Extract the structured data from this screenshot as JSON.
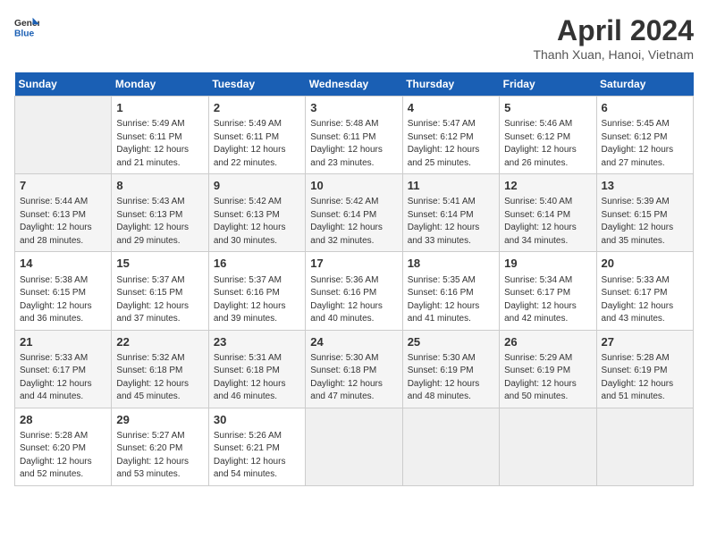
{
  "header": {
    "logo_line1": "General",
    "logo_line2": "Blue",
    "month_title": "April 2024",
    "location": "Thanh Xuan, Hanoi, Vietnam"
  },
  "weekdays": [
    "Sunday",
    "Monday",
    "Tuesday",
    "Wednesday",
    "Thursday",
    "Friday",
    "Saturday"
  ],
  "weeks": [
    [
      {
        "day": "",
        "sunrise": "",
        "sunset": "",
        "daylight": ""
      },
      {
        "day": "1",
        "sunrise": "Sunrise: 5:49 AM",
        "sunset": "Sunset: 6:11 PM",
        "daylight": "Daylight: 12 hours and 21 minutes."
      },
      {
        "day": "2",
        "sunrise": "Sunrise: 5:49 AM",
        "sunset": "Sunset: 6:11 PM",
        "daylight": "Daylight: 12 hours and 22 minutes."
      },
      {
        "day": "3",
        "sunrise": "Sunrise: 5:48 AM",
        "sunset": "Sunset: 6:11 PM",
        "daylight": "Daylight: 12 hours and 23 minutes."
      },
      {
        "day": "4",
        "sunrise": "Sunrise: 5:47 AM",
        "sunset": "Sunset: 6:12 PM",
        "daylight": "Daylight: 12 hours and 25 minutes."
      },
      {
        "day": "5",
        "sunrise": "Sunrise: 5:46 AM",
        "sunset": "Sunset: 6:12 PM",
        "daylight": "Daylight: 12 hours and 26 minutes."
      },
      {
        "day": "6",
        "sunrise": "Sunrise: 5:45 AM",
        "sunset": "Sunset: 6:12 PM",
        "daylight": "Daylight: 12 hours and 27 minutes."
      }
    ],
    [
      {
        "day": "7",
        "sunrise": "Sunrise: 5:44 AM",
        "sunset": "Sunset: 6:13 PM",
        "daylight": "Daylight: 12 hours and 28 minutes."
      },
      {
        "day": "8",
        "sunrise": "Sunrise: 5:43 AM",
        "sunset": "Sunset: 6:13 PM",
        "daylight": "Daylight: 12 hours and 29 minutes."
      },
      {
        "day": "9",
        "sunrise": "Sunrise: 5:42 AM",
        "sunset": "Sunset: 6:13 PM",
        "daylight": "Daylight: 12 hours and 30 minutes."
      },
      {
        "day": "10",
        "sunrise": "Sunrise: 5:42 AM",
        "sunset": "Sunset: 6:14 PM",
        "daylight": "Daylight: 12 hours and 32 minutes."
      },
      {
        "day": "11",
        "sunrise": "Sunrise: 5:41 AM",
        "sunset": "Sunset: 6:14 PM",
        "daylight": "Daylight: 12 hours and 33 minutes."
      },
      {
        "day": "12",
        "sunrise": "Sunrise: 5:40 AM",
        "sunset": "Sunset: 6:14 PM",
        "daylight": "Daylight: 12 hours and 34 minutes."
      },
      {
        "day": "13",
        "sunrise": "Sunrise: 5:39 AM",
        "sunset": "Sunset: 6:15 PM",
        "daylight": "Daylight: 12 hours and 35 minutes."
      }
    ],
    [
      {
        "day": "14",
        "sunrise": "Sunrise: 5:38 AM",
        "sunset": "Sunset: 6:15 PM",
        "daylight": "Daylight: 12 hours and 36 minutes."
      },
      {
        "day": "15",
        "sunrise": "Sunrise: 5:37 AM",
        "sunset": "Sunset: 6:15 PM",
        "daylight": "Daylight: 12 hours and 37 minutes."
      },
      {
        "day": "16",
        "sunrise": "Sunrise: 5:37 AM",
        "sunset": "Sunset: 6:16 PM",
        "daylight": "Daylight: 12 hours and 39 minutes."
      },
      {
        "day": "17",
        "sunrise": "Sunrise: 5:36 AM",
        "sunset": "Sunset: 6:16 PM",
        "daylight": "Daylight: 12 hours and 40 minutes."
      },
      {
        "day": "18",
        "sunrise": "Sunrise: 5:35 AM",
        "sunset": "Sunset: 6:16 PM",
        "daylight": "Daylight: 12 hours and 41 minutes."
      },
      {
        "day": "19",
        "sunrise": "Sunrise: 5:34 AM",
        "sunset": "Sunset: 6:17 PM",
        "daylight": "Daylight: 12 hours and 42 minutes."
      },
      {
        "day": "20",
        "sunrise": "Sunrise: 5:33 AM",
        "sunset": "Sunset: 6:17 PM",
        "daylight": "Daylight: 12 hours and 43 minutes."
      }
    ],
    [
      {
        "day": "21",
        "sunrise": "Sunrise: 5:33 AM",
        "sunset": "Sunset: 6:17 PM",
        "daylight": "Daylight: 12 hours and 44 minutes."
      },
      {
        "day": "22",
        "sunrise": "Sunrise: 5:32 AM",
        "sunset": "Sunset: 6:18 PM",
        "daylight": "Daylight: 12 hours and 45 minutes."
      },
      {
        "day": "23",
        "sunrise": "Sunrise: 5:31 AM",
        "sunset": "Sunset: 6:18 PM",
        "daylight": "Daylight: 12 hours and 46 minutes."
      },
      {
        "day": "24",
        "sunrise": "Sunrise: 5:30 AM",
        "sunset": "Sunset: 6:18 PM",
        "daylight": "Daylight: 12 hours and 47 minutes."
      },
      {
        "day": "25",
        "sunrise": "Sunrise: 5:30 AM",
        "sunset": "Sunset: 6:19 PM",
        "daylight": "Daylight: 12 hours and 48 minutes."
      },
      {
        "day": "26",
        "sunrise": "Sunrise: 5:29 AM",
        "sunset": "Sunset: 6:19 PM",
        "daylight": "Daylight: 12 hours and 50 minutes."
      },
      {
        "day": "27",
        "sunrise": "Sunrise: 5:28 AM",
        "sunset": "Sunset: 6:19 PM",
        "daylight": "Daylight: 12 hours and 51 minutes."
      }
    ],
    [
      {
        "day": "28",
        "sunrise": "Sunrise: 5:28 AM",
        "sunset": "Sunset: 6:20 PM",
        "daylight": "Daylight: 12 hours and 52 minutes."
      },
      {
        "day": "29",
        "sunrise": "Sunrise: 5:27 AM",
        "sunset": "Sunset: 6:20 PM",
        "daylight": "Daylight: 12 hours and 53 minutes."
      },
      {
        "day": "30",
        "sunrise": "Sunrise: 5:26 AM",
        "sunset": "Sunset: 6:21 PM",
        "daylight": "Daylight: 12 hours and 54 minutes."
      },
      {
        "day": "",
        "sunrise": "",
        "sunset": "",
        "daylight": ""
      },
      {
        "day": "",
        "sunrise": "",
        "sunset": "",
        "daylight": ""
      },
      {
        "day": "",
        "sunrise": "",
        "sunset": "",
        "daylight": ""
      },
      {
        "day": "",
        "sunrise": "",
        "sunset": "",
        "daylight": ""
      }
    ]
  ]
}
